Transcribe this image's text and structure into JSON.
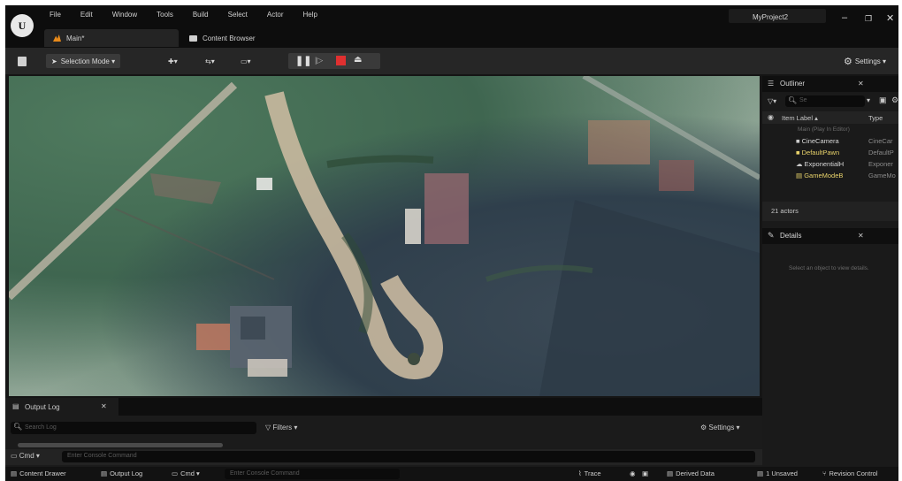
{
  "menu": [
    "File",
    "Edit",
    "Window",
    "Tools",
    "Build",
    "Select",
    "Actor",
    "Help"
  ],
  "project_name": "MyProject2",
  "tabs": {
    "main": "Main*",
    "content_browser": "Content Browser"
  },
  "toolbar": {
    "selection_mode": "Selection Mode ▾",
    "settings": "Settings ▾"
  },
  "outliner": {
    "title": "Outliner",
    "search_placeholder": "Se",
    "col_label": "Item Label ▴",
    "col_type": "Type",
    "drop_hint": "Main (Play In Editor)",
    "items": [
      {
        "label": "CineCamera",
        "type": "CineCar"
      },
      {
        "label": "DefaultPawn",
        "type": "DefaultP"
      },
      {
        "label": "ExponentialH",
        "type": "Exponer"
      },
      {
        "label": "GameModeB",
        "type": "GameMo"
      }
    ],
    "actor_count": "21 actors"
  },
  "details": {
    "title": "Details",
    "empty_message": "Select an object to view details."
  },
  "output_log": {
    "title": "Output Log",
    "search_placeholder": "Search Log",
    "filters": "Filters ▾",
    "settings": "Settings ▾",
    "cmd": "Cmd ▾",
    "cmd_placeholder": "Enter Console Command"
  },
  "statusbar": {
    "content_drawer": "Content Drawer",
    "output_log": "Output Log",
    "cmd": "Cmd ▾",
    "cmd_placeholder": "Enter Console Command",
    "trace": "Trace",
    "derived_data": "Derived Data",
    "unsaved": "1 Unsaved",
    "revision_control": "Revision Control"
  },
  "colors": {
    "accent_orange": "#e88a1a",
    "stop_red": "#e03030",
    "outliner_item_yellow": "#e8d26a"
  }
}
